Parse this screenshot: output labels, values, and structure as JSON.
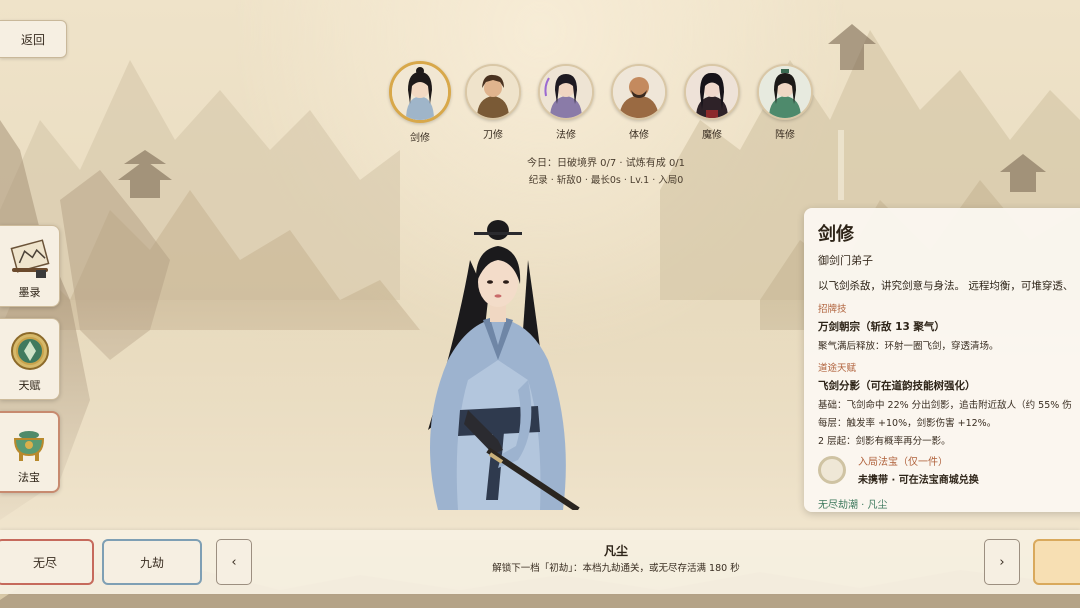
{
  "top": {
    "back_label": "返回"
  },
  "characters": [
    {
      "label": "剑修",
      "selected": true
    },
    {
      "label": "刀修",
      "selected": false
    },
    {
      "label": "法修",
      "selected": false
    },
    {
      "label": "体修",
      "selected": false
    },
    {
      "label": "魔修",
      "selected": false
    },
    {
      "label": "阵修",
      "selected": false
    }
  ],
  "stats": {
    "today": "今日：日破境界 0/7  ·  试炼有成 0/1",
    "record": "纪录 · 斩敌0 · 最长0s · Lv.1 · 入局0"
  },
  "sidebar": {
    "items": [
      {
        "label": "墨录"
      },
      {
        "label": "天赋"
      },
      {
        "label": "法宝"
      }
    ]
  },
  "panel": {
    "title": "剑修",
    "subtitle": "御剑门弟子",
    "description": "以飞剑杀敌，讲究剑意与身法。 远程均衡，可堆穿透、",
    "signature_header": "招牌技",
    "signature_name": "万剑朝宗（斩敌 13 聚气）",
    "signature_desc": "聚气满后释放：环射一圈飞剑，穿透清场。",
    "talent_header": "道途天赋",
    "talent_name": "飞剑分影（可在道韵技能树强化）",
    "talent_lines": [
      "基础：飞剑命中 22% 分出剑影，追击附近敌人（约 55% 伤",
      "每层：触发率 +10%，剑影伤害 +12%。",
      "2 层起：剑影有概率再分一影。"
    ],
    "treasure_title": "入局法宝（仅一件）",
    "treasure_status": "未携带 · 可在法宝商城兑换",
    "footer": "无尽劫潮 · 凡尘"
  },
  "bottom": {
    "mode_endless": "无尽",
    "mode_nine": "九劫",
    "prev_arrow": "‹",
    "next_arrow": "›",
    "level_name": "凡尘",
    "unlock_text": "解锁下一档「初劫」：本档九劫通关，或无尽存活满 180 秒"
  },
  "colors": {
    "accent_gold": "#d8a84a",
    "accent_red": "#c66a5c",
    "accent_blue": "#7e9fb4",
    "section_orange": "#b0623c",
    "footer_green": "#3f7a5e"
  },
  "icons": {
    "sidebar": [
      "scroll-painting-icon",
      "jade-seal-icon",
      "bronze-cauldron-icon"
    ],
    "treasure": "empty-treasure-ring-icon"
  }
}
